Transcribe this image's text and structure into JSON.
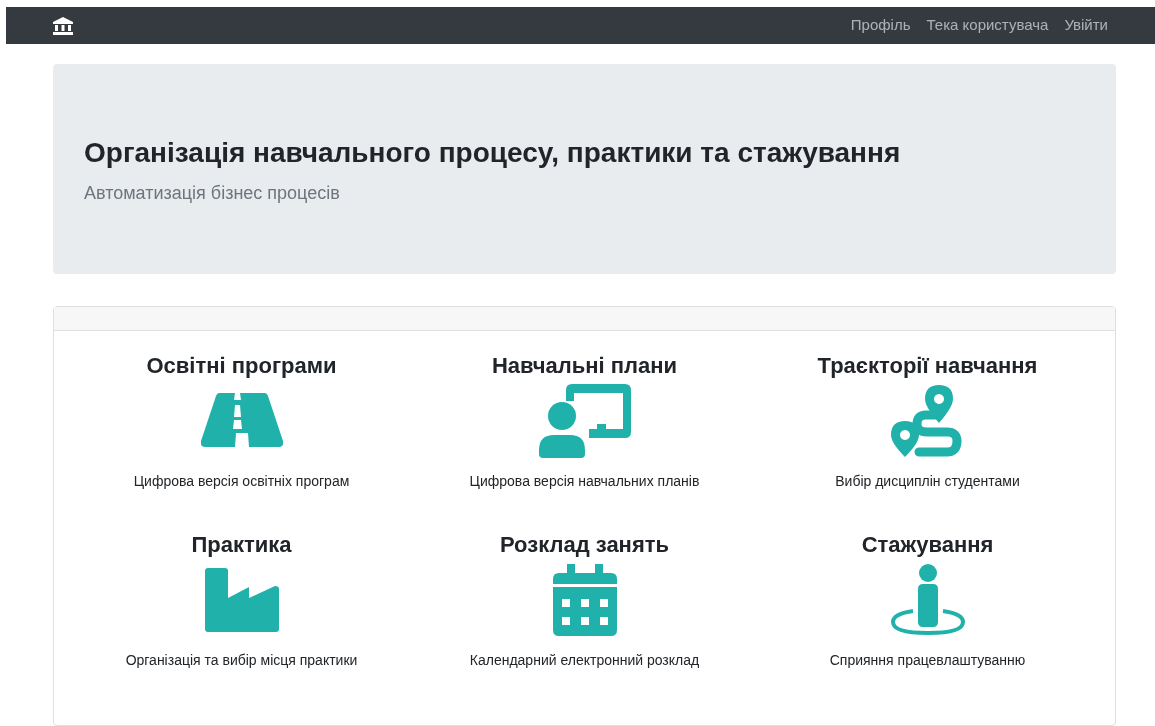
{
  "navbar": {
    "links": [
      "Профіль",
      "Тека користувача",
      "Увійти"
    ]
  },
  "hero": {
    "title": "Організація навчального процесу, практики та стажування",
    "subtitle": "Автоматизація бізнес процесів"
  },
  "features": [
    {
      "title": "Освітні програми",
      "description": "Цифрова версія освітніх програм"
    },
    {
      "title": "Навчальні плани",
      "description": "Цифрова версія навчальних планів"
    },
    {
      "title": "Траєкторії навчання",
      "description": "Вибір дисциплін студентами"
    },
    {
      "title": "Практика",
      "description": "Організація та вибір місця практики"
    },
    {
      "title": "Розклад занять",
      "description": "Календарний електронний розклад"
    },
    {
      "title": "Стажування",
      "description": "Сприяння працевлаштуванню"
    }
  ]
}
